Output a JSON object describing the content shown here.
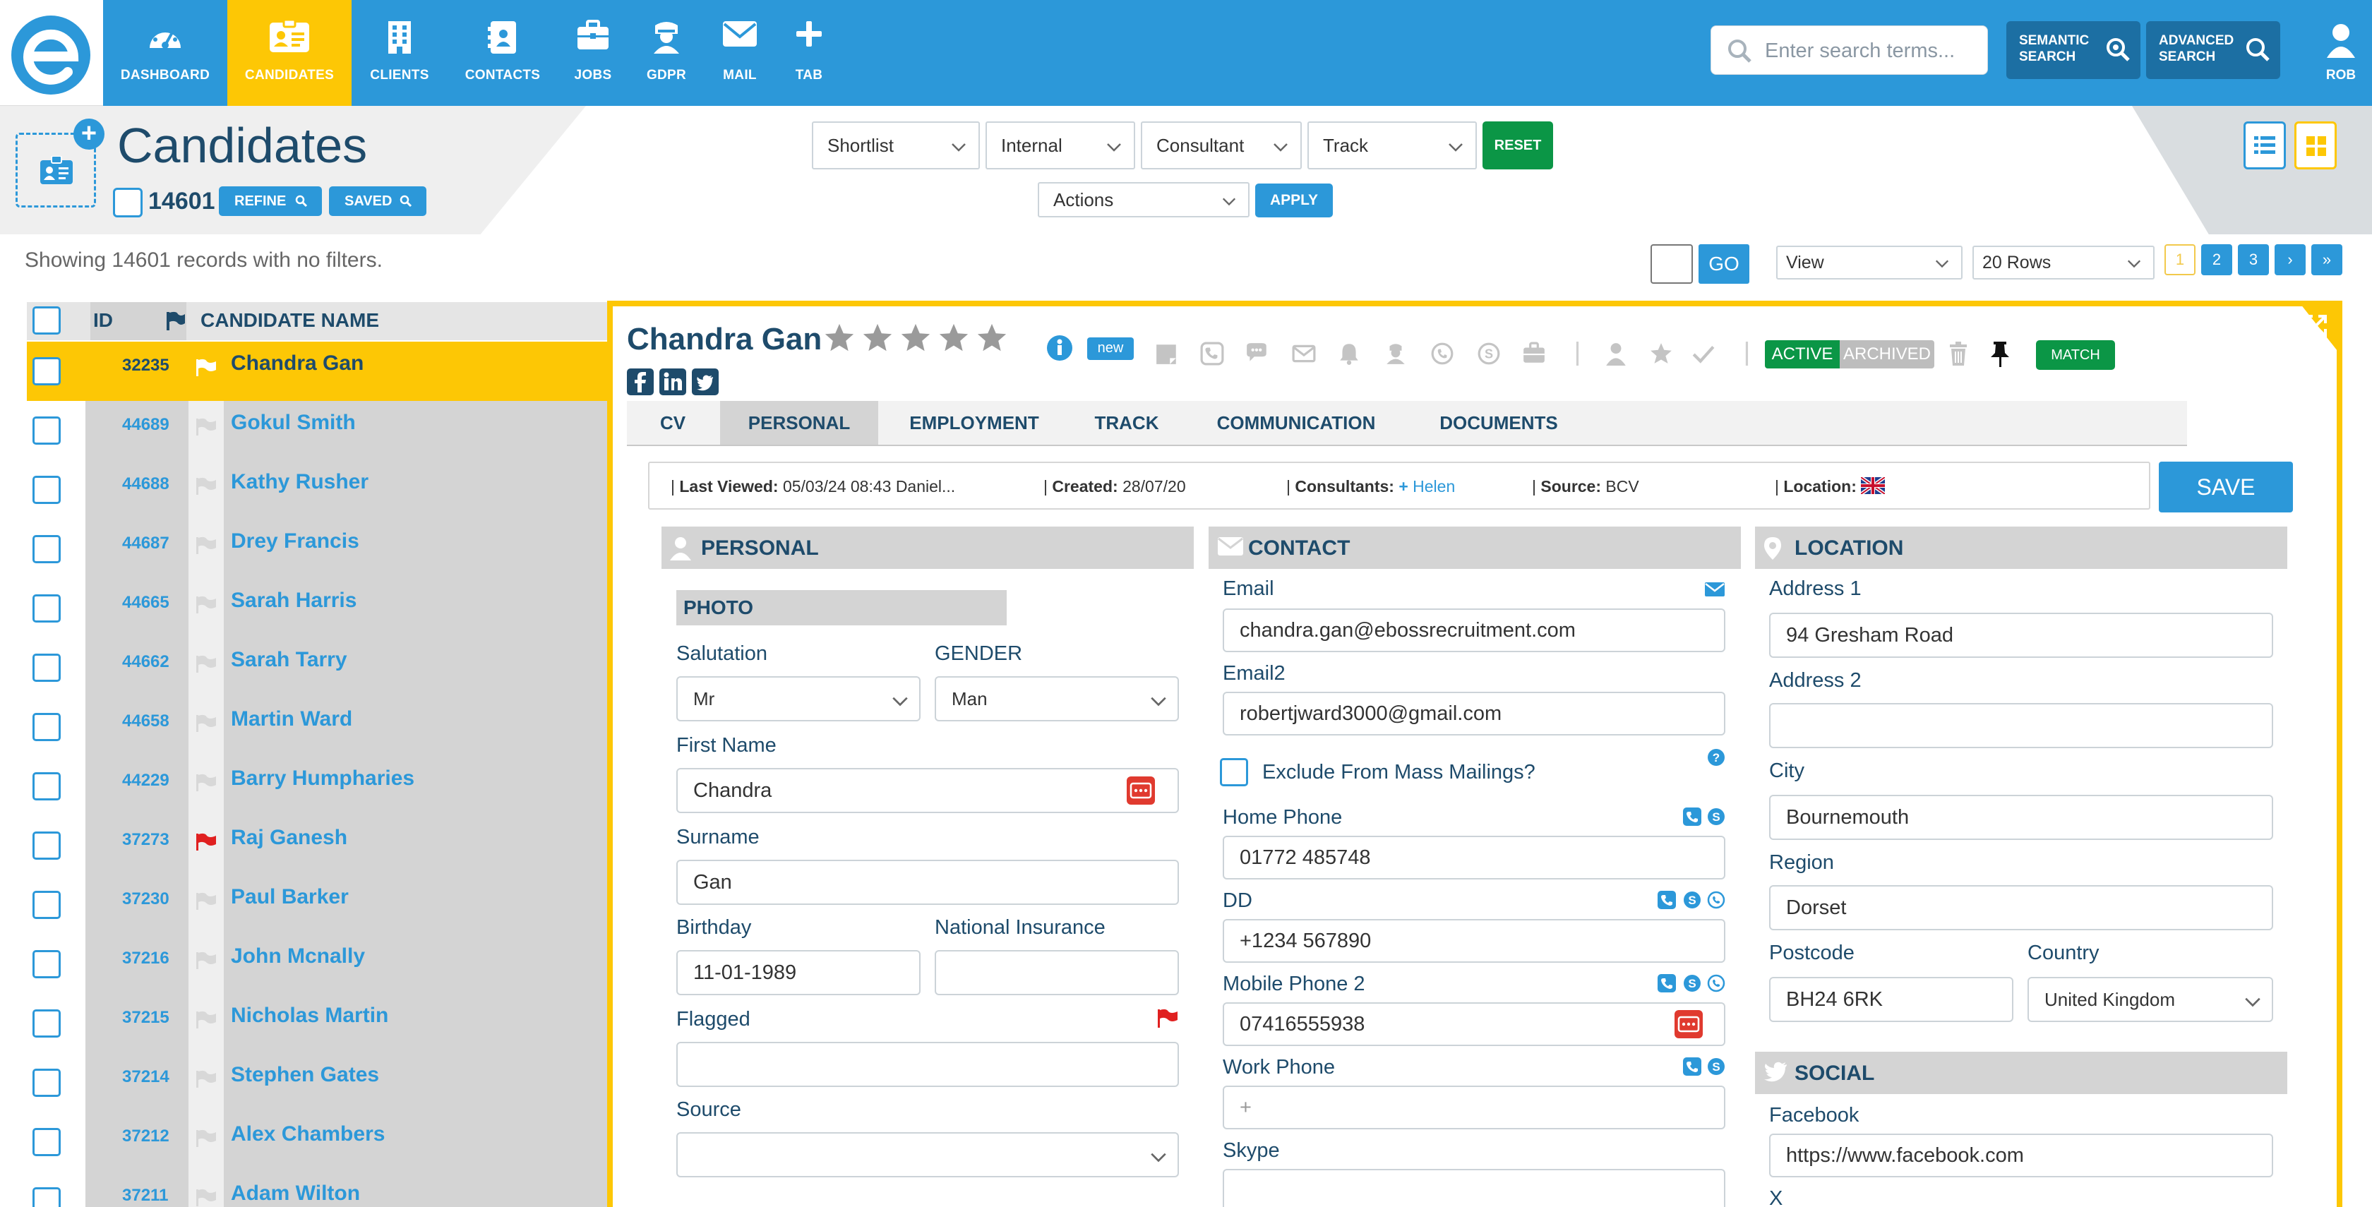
{
  "nav": {
    "items": [
      {
        "label": "DASHBOARD",
        "icon": "dashboard-icon"
      },
      {
        "label": "CANDIDATES",
        "icon": "candidates-icon",
        "active": true
      },
      {
        "label": "CLIENTS",
        "icon": "clients-icon"
      },
      {
        "label": "CONTACTS",
        "icon": "contacts-icon"
      },
      {
        "label": "JOBS",
        "icon": "jobs-icon"
      },
      {
        "label": "GDPR",
        "icon": "gdpr-icon"
      },
      {
        "label": "MAIL",
        "icon": "mail-icon"
      },
      {
        "label": "TAB",
        "icon": "plus-icon"
      }
    ],
    "search_placeholder": "Enter search terms...",
    "semantic_search": [
      "SEMANTIC",
      "SEARCH"
    ],
    "advanced_search": [
      "ADVANCED",
      "SEARCH"
    ],
    "user": "ROB"
  },
  "header": {
    "title": "Candidates",
    "count": "14601",
    "refine_label": "REFINE",
    "saved_label": "SAVED",
    "filters": {
      "shortlist": "Shortlist",
      "internal": "Internal",
      "consultant": "Consultant",
      "track": "Track"
    },
    "reset_label": "RESET",
    "actions": "Actions",
    "apply_label": "APPLY"
  },
  "toolbar": {
    "showing": "Showing 14601 records with no filters.",
    "go_label": "GO",
    "view": "View",
    "rows": "20 Rows",
    "pages": [
      "1",
      "2",
      "3",
      "›",
      "»"
    ]
  },
  "list": {
    "headers": {
      "id": "ID",
      "name": "CANDIDATE NAME"
    },
    "rows": [
      {
        "id": "32235",
        "name": "Chandra Gan",
        "flag": "selected"
      },
      {
        "id": "44689",
        "name": "Gokul Smith",
        "flag": "none"
      },
      {
        "id": "44688",
        "name": "Kathy Rusher",
        "flag": "none"
      },
      {
        "id": "44687",
        "name": "Drey Francis",
        "flag": "none"
      },
      {
        "id": "44665",
        "name": "Sarah Harris",
        "flag": "none"
      },
      {
        "id": "44662",
        "name": "Sarah Tarry",
        "flag": "none"
      },
      {
        "id": "44658",
        "name": "Martin Ward",
        "flag": "none"
      },
      {
        "id": "44229",
        "name": "Barry Humpharies",
        "flag": "none"
      },
      {
        "id": "37273",
        "name": "Raj Ganesh",
        "flag": "red"
      },
      {
        "id": "37230",
        "name": "Paul Barker",
        "flag": "none"
      },
      {
        "id": "37216",
        "name": "John Mcnally",
        "flag": "none"
      },
      {
        "id": "37215",
        "name": "Nicholas Martin",
        "flag": "none"
      },
      {
        "id": "37214",
        "name": "Stephen Gates",
        "flag": "none"
      },
      {
        "id": "37212",
        "name": "Alex Chambers",
        "flag": "none"
      },
      {
        "id": "37211",
        "name": "Adam Wilton",
        "flag": "none"
      }
    ]
  },
  "detail": {
    "name": "Chandra Gan",
    "rating": 0,
    "badge_new": "new",
    "status_active": "ACTIVE",
    "status_archived": "ARCHIVED",
    "match_label": "MATCH",
    "tabs": [
      "CV",
      "PERSONAL",
      "EMPLOYMENT",
      "TRACK",
      "COMMUNICATION",
      "DOCUMENTS"
    ],
    "active_tab": "PERSONAL",
    "info": {
      "last_viewed_label": "Last Viewed:",
      "last_viewed": "05/03/24 08:43 Daniel...",
      "created_label": "Created:",
      "created": "28/07/20",
      "consultants_label": "Consultants:",
      "consultant": "Helen",
      "source_label": "Source:",
      "source": "BCV",
      "location_label": "Location:"
    },
    "save_label": "SAVE",
    "personal": {
      "title": "PERSONAL",
      "photo_label": "PHOTO",
      "salutation_label": "Salutation",
      "salutation": "Mr",
      "gender_label": "GENDER",
      "gender": "Man",
      "first_name_label": "First Name",
      "first_name": "Chandra",
      "surname_label": "Surname",
      "surname": "Gan",
      "birthday_label": "Birthday",
      "birthday": "11-01-1989",
      "ni_label": "National Insurance",
      "ni": "",
      "flagged_label": "Flagged",
      "flagged": "",
      "source_label": "Source",
      "source": ""
    },
    "contact": {
      "title": "CONTACT",
      "email_label": "Email",
      "email": "chandra.gan@ebossrecruitment.com",
      "email2_label": "Email2",
      "email2": "robertjward3000@gmail.com",
      "exclude_label": "Exclude From Mass Mailings?",
      "home_phone_label": "Home Phone",
      "home_phone": "01772 485748",
      "dd_label": "DD",
      "dd": "+1234 567890",
      "mobile2_label": "Mobile Phone 2",
      "mobile2": "07416555938",
      "work_phone_label": "Work Phone",
      "work_phone": "+",
      "skype_label": "Skype",
      "skype": ""
    },
    "location": {
      "title": "LOCATION",
      "address1_label": "Address 1",
      "address1": "94 Gresham Road",
      "address2_label": "Address 2",
      "address2": "",
      "city_label": "City",
      "city": "Bournemouth",
      "region_label": "Region",
      "region": "Dorset",
      "postcode_label": "Postcode",
      "postcode": "BH24 6RK",
      "country_label": "Country",
      "country": "United Kingdom"
    },
    "social": {
      "title": "SOCIAL",
      "facebook_label": "Facebook",
      "facebook": "https://www.facebook.com",
      "x_label": "X"
    }
  },
  "colors": {
    "primary": "#2c98d9",
    "accent": "#fdc705",
    "navy": "#1e4b6b",
    "green": "#0b9646",
    "red": "#e03a2f"
  }
}
